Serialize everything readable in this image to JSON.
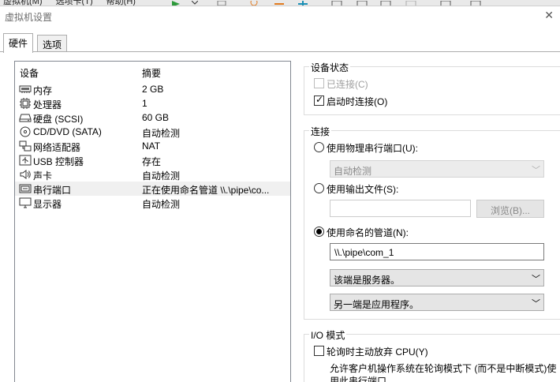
{
  "menubar": {
    "items": [
      "虚拟机(M)",
      "选项卡(T)",
      "帮助(H)"
    ]
  },
  "window": {
    "title": "虚拟机设置",
    "close_glyph": "✕"
  },
  "tabs": [
    {
      "label": "硬件"
    },
    {
      "label": "选项"
    }
  ],
  "devices": {
    "header": {
      "device": "设备",
      "summary": "摘要"
    },
    "rows": [
      {
        "name": "内存",
        "summary": "2 GB",
        "icon": "memory-icon"
      },
      {
        "name": "处理器",
        "summary": "1",
        "icon": "cpu-icon"
      },
      {
        "name": "硬盘 (SCSI)",
        "summary": "60 GB",
        "icon": "harddisk-icon"
      },
      {
        "name": "CD/DVD (SATA)",
        "summary": "自动检测",
        "icon": "cd-dvd-icon"
      },
      {
        "name": "网络适配器",
        "summary": "NAT",
        "icon": "network-adapter-icon"
      },
      {
        "name": "USB 控制器",
        "summary": "存在",
        "icon": "usb-icon"
      },
      {
        "name": "声卡",
        "summary": "自动检测",
        "icon": "sound-card-icon"
      },
      {
        "name": "串行端口",
        "summary": "正在使用命名管道 \\\\.\\pipe\\co...",
        "icon": "serial-port-icon"
      },
      {
        "name": "显示器",
        "summary": "自动检测",
        "icon": "display-icon"
      }
    ]
  },
  "device_status": {
    "title": "设备状态",
    "connected": {
      "label": "已连接(C)",
      "checked": false,
      "disabled": true
    },
    "connect_at_power_on": {
      "label": "启动时连接(O)",
      "checked": true
    }
  },
  "connection": {
    "title": "连接",
    "physical_port": {
      "label": "使用物理串行端口(U):",
      "selected": false,
      "combo_value": "自动检测"
    },
    "output_file": {
      "label": "使用输出文件(S):",
      "selected": false,
      "path": "",
      "browse_label": "浏览(B)..."
    },
    "named_pipe": {
      "label": "使用命名的管道(N):",
      "selected": true,
      "pipe_name": "\\\\.\\pipe\\com_1",
      "end_option": "该端是服务器。",
      "other_end_option": "另一端是应用程序。"
    }
  },
  "io_mode": {
    "title": "I/O 模式",
    "yield_cpu": {
      "label": "轮询时主动放弃 CPU(Y)",
      "checked": false
    },
    "description": "允许客户机操作系统在轮询模式下 (而不是中断模式)使用此串行端口。"
  }
}
